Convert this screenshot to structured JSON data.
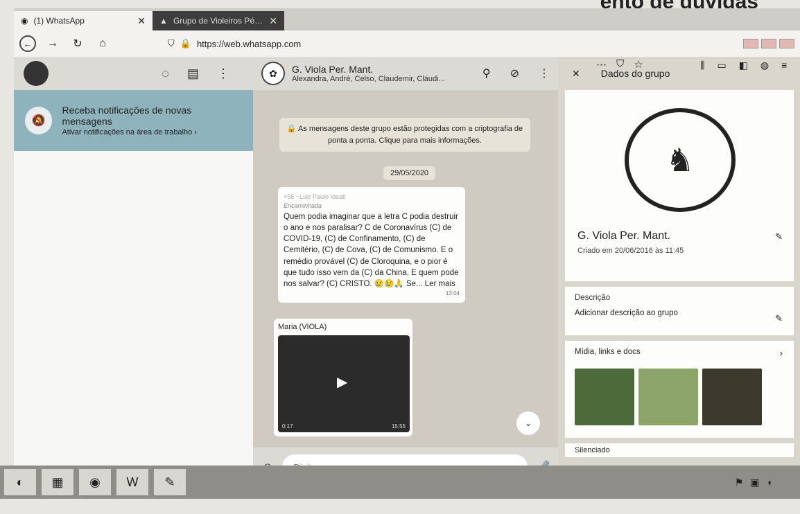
{
  "page_heading": "ento de dúvidas",
  "browser": {
    "tabs": [
      {
        "title": "(1) WhatsApp",
        "close": "✕",
        "active": true
      },
      {
        "title": "Grupo de Violeiros Pérola da M",
        "close": "✕",
        "active": false
      }
    ],
    "url": "https://web.whatsapp.com",
    "toolbar_icons": [
      "more-icon",
      "pocket-icon",
      "star-icon"
    ],
    "toolbar_far_icons": [
      "library-icon",
      "sidebar-icon",
      "extension-icon",
      "globe-icon",
      "menu-icon"
    ]
  },
  "left_pane": {
    "notification": {
      "title": "Receba notificações de novas mensagens",
      "subtitle": "Ativar notificações na área de trabalho ›"
    }
  },
  "chat": {
    "group_name": "G. Viola Per. Mant.",
    "members": "Alexandra, André, Celso, Claudemir, Cláudi...",
    "system_message": "🔒 As mensagens deste grupo estão protegidas com a criptografia de ponta a ponta. Clique para mais informações.",
    "date": "29/05/2020",
    "message": {
      "sender": "+55 ~Luiz Paulo Ideati",
      "forwarded": "Encaminhada",
      "text": "Quem podia imaginar que a letra C podia destruir o ano e nos paralisar? C de Coronavírus (C) de COVID-19, (C) de Confinamento, (C) de Cemitério, (C) de Cova, (C) de Comunismo. E o remédio provável (C) de Cloroquina, e o pior é que tudo isso vem da (C) da China. E quem pode nos salvar? (C) CRISTO. 😢😢🙏 Se... Ler mais",
      "time": "13:04"
    },
    "media_message": {
      "sender": "Maria (VIOLA)",
      "duration": "0:17",
      "time": "15:55"
    },
    "compose_placeholder": "Digite uma mensagem"
  },
  "info_pane": {
    "title": "Dados do grupo",
    "group_name": "G. Viola Per. Mant.",
    "created": "Criado em 20/06/2016 às 11:45",
    "description_label": "Descrição",
    "description_action": "Adicionar descrição ao grupo",
    "media_label": "Mídia, links e docs",
    "silenced_label": "Silenciado"
  },
  "taskbar": {
    "icons": [
      "start-icon",
      "files-icon",
      "firefox-icon",
      "word-icon",
      "paint-icon"
    ]
  }
}
